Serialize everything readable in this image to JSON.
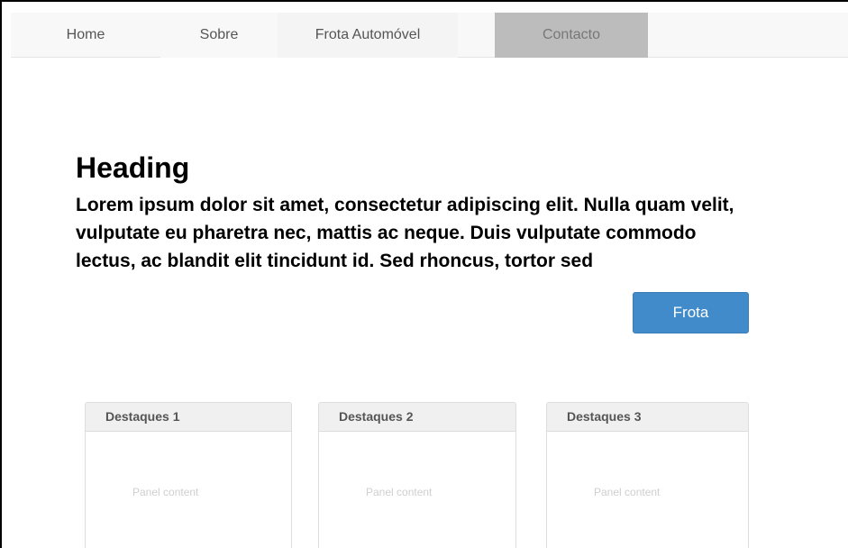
{
  "navbar": {
    "items": [
      {
        "label": "Home"
      },
      {
        "label": "Sobre"
      },
      {
        "label": "Frota Automóvel"
      },
      {
        "label": "Contacto"
      }
    ]
  },
  "hero": {
    "heading": "Heading",
    "lead": "Lorem ipsum dolor sit amet, consectetur adipiscing elit. Nulla quam velit, vulputate eu pharetra nec, mattis ac neque. Duis vulputate commodo lectus, ac blandit elit tincidunt id. Sed rhoncus, tortor sed",
    "button_label": "Frota"
  },
  "panels": [
    {
      "title": "Destaques 1",
      "content": "Panel content"
    },
    {
      "title": "Destaques 2",
      "content": "Panel content"
    },
    {
      "title": "Destaques 3",
      "content": "Panel content"
    }
  ],
  "colors": {
    "primary_button": "#428bca",
    "active_nav": "#bcbcbc",
    "navbar_bg": "#f8f8f8"
  }
}
